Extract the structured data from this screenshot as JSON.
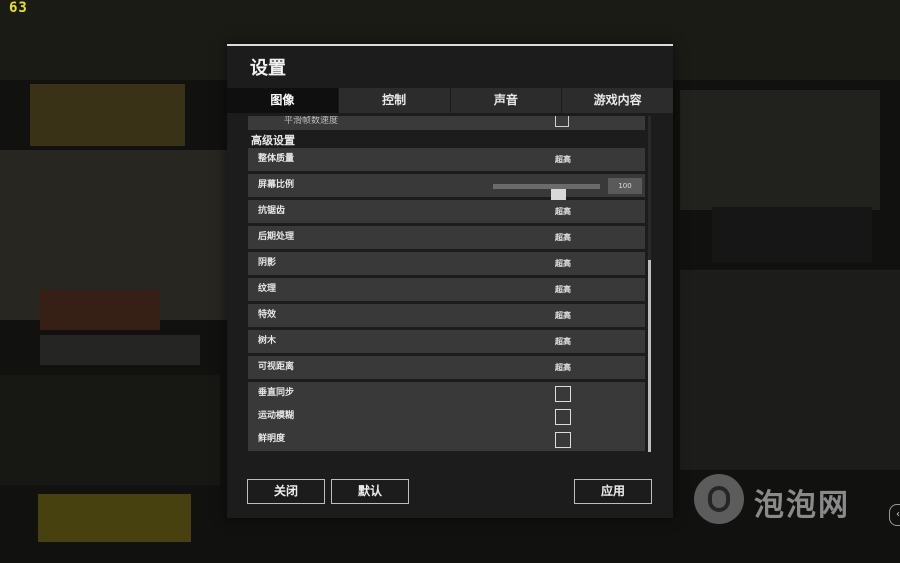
{
  "overlay": {
    "fps_counter": "63"
  },
  "dialog": {
    "title": "设置"
  },
  "tabs": [
    {
      "label": "图像",
      "active": true
    },
    {
      "label": "控制",
      "active": false
    },
    {
      "label": "声音",
      "active": false
    },
    {
      "label": "游戏内容",
      "active": false
    }
  ],
  "graphics": {
    "partial_item": {
      "label": "平滑帧数速度",
      "checked": false
    },
    "section_title": "高级设置",
    "rows": [
      {
        "label": "整体质量",
        "type": "value",
        "value": "超高"
      },
      {
        "label": "屏幕比例",
        "type": "slider",
        "value": "100",
        "percent": 0.5
      },
      {
        "label": "抗锯齿",
        "type": "value",
        "value": "超高"
      },
      {
        "label": "后期处理",
        "type": "value",
        "value": "超高"
      },
      {
        "label": "阴影",
        "type": "value",
        "value": "超高"
      },
      {
        "label": "纹理",
        "type": "value",
        "value": "超高"
      },
      {
        "label": "特效",
        "type": "value",
        "value": "超高"
      },
      {
        "label": "树木",
        "type": "value",
        "value": "超高"
      },
      {
        "label": "可视距离",
        "type": "value",
        "value": "超高"
      },
      {
        "label": "垂直同步",
        "type": "checkbox",
        "checked": false
      },
      {
        "label": "运动模糊",
        "type": "checkbox",
        "checked": false
      },
      {
        "label": "鲜明度",
        "type": "checkbox",
        "checked": false
      }
    ]
  },
  "buttons": {
    "close": "关闭",
    "default": "默认",
    "apply": "应用"
  },
  "watermark": {
    "text": "泡泡网"
  },
  "colors": {
    "fps": "#e9e21c",
    "dialog_bg": "#1c1c1c",
    "row_bg": "#393939",
    "active_tab": "#0f0f0f"
  }
}
